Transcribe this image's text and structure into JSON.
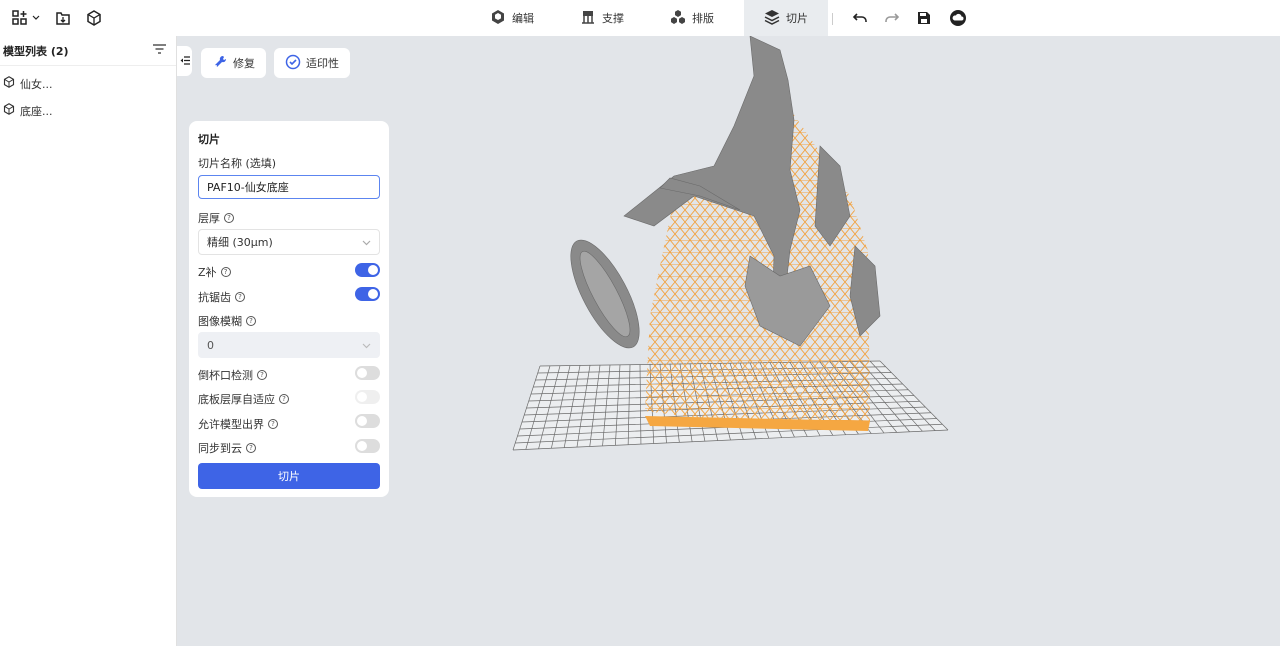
{
  "topbar": {
    "left_icons": [
      "add-model-icon",
      "import-icon",
      "model-cube-icon"
    ],
    "tabs": [
      {
        "label": "编辑",
        "icon": "edit-cube-icon",
        "active": false
      },
      {
        "label": "支撑",
        "icon": "support-icon",
        "active": false
      },
      {
        "label": "排版",
        "icon": "layout-icon",
        "active": false
      },
      {
        "label": "切片",
        "icon": "layers-icon",
        "active": true
      }
    ],
    "right_icons": [
      "undo-icon",
      "redo-icon",
      "save-icon",
      "cloud-icon"
    ]
  },
  "sidebar": {
    "title": "模型列表 (2)",
    "items": [
      {
        "label": "仙女..."
      },
      {
        "label": "底座..."
      }
    ]
  },
  "actions": {
    "repair_label": "修复",
    "printability_label": "适印性"
  },
  "panel": {
    "title": "切片",
    "name_label": "切片名称 (选填)",
    "name_value": "PAF10-仙女底座",
    "layer_label": "层厚",
    "layer_value": "精细 (30μm)",
    "zcomp_label": "Z补",
    "zcomp_on": true,
    "aa_label": "抗锯齿",
    "aa_on": true,
    "blur_label": "图像模糊",
    "blur_value": "0",
    "cup_label": "倒杯口检测",
    "cup_on": false,
    "base_label": "底板层厚自适应",
    "base_on": false,
    "outside_label": "允许模型出界",
    "outside_on": false,
    "cloud_label": "同步到云",
    "cloud_on": false,
    "slice_button": "切片"
  },
  "colors": {
    "accent": "#3e64e6",
    "support": "#f5a742",
    "model": "#8a8a8a",
    "viewport_bg": "#e2e5e9"
  }
}
